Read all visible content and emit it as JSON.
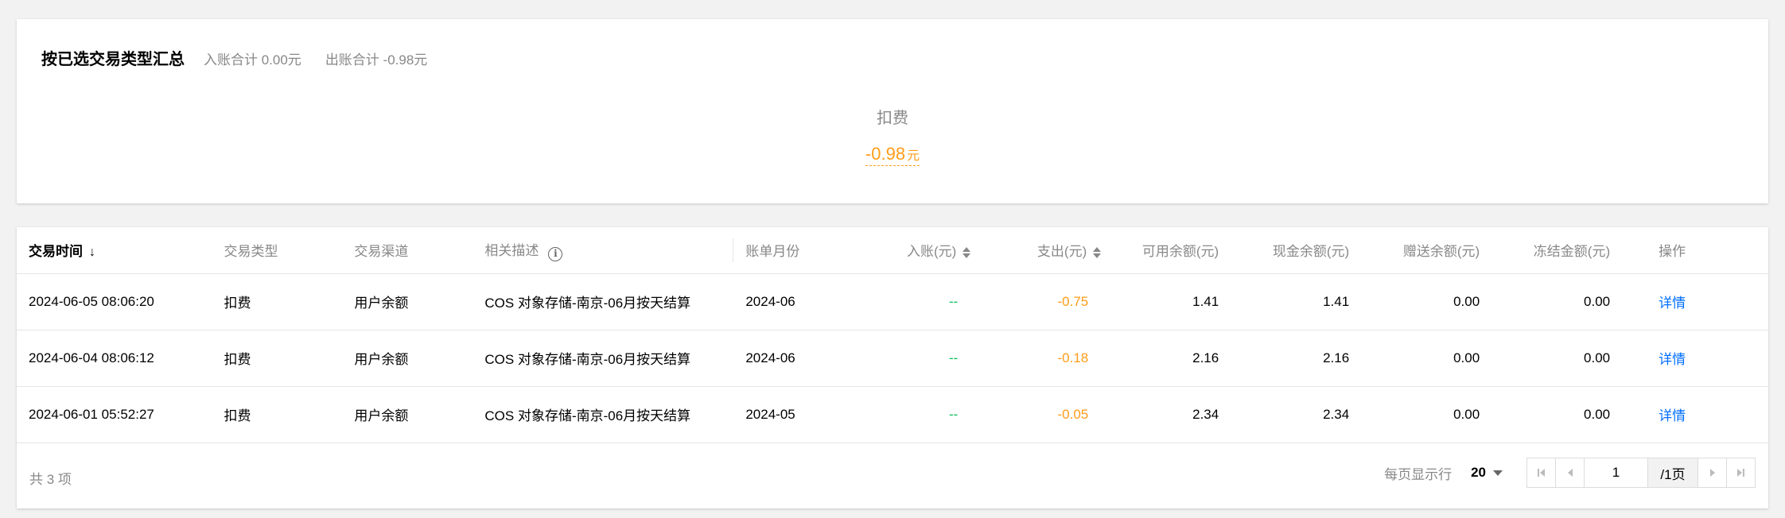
{
  "summary": {
    "title": "按已选交易类型汇总",
    "income_total": "入账合计 0.00元",
    "expense_total": "出账合计 -0.98元",
    "type_label": "扣费",
    "amount": "-0.98",
    "unit": "元"
  },
  "table": {
    "headers": {
      "time": "交易时间",
      "type": "交易类型",
      "channel": "交易渠道",
      "desc": "相关描述",
      "month": "账单月份",
      "income": "入账(元)",
      "expense": "支出(元)",
      "available": "可用余额(元)",
      "cash": "现金余额(元)",
      "gift": "赠送余额(元)",
      "frozen": "冻结金额(元)",
      "action": "操作"
    },
    "rows": [
      {
        "time": "2024-06-05 08:06:20",
        "type": "扣费",
        "channel": "用户余额",
        "desc": "COS 对象存储-南京-06月按天结算",
        "month": "2024-06",
        "income": "--",
        "expense": "-0.75",
        "available": "1.41",
        "cash": "1.41",
        "gift": "0.00",
        "frozen": "0.00",
        "action": "详情"
      },
      {
        "time": "2024-06-04 08:06:12",
        "type": "扣费",
        "channel": "用户余额",
        "desc": "COS 对象存储-南京-06月按天结算",
        "month": "2024-06",
        "income": "--",
        "expense": "-0.18",
        "available": "2.16",
        "cash": "2.16",
        "gift": "0.00",
        "frozen": "0.00",
        "action": "详情"
      },
      {
        "time": "2024-06-01 05:52:27",
        "type": "扣费",
        "channel": "用户余额",
        "desc": "COS 对象存储-南京-06月按天结算",
        "month": "2024-05",
        "income": "--",
        "expense": "-0.05",
        "available": "2.34",
        "cash": "2.34",
        "gift": "0.00",
        "frozen": "0.00",
        "action": "详情"
      }
    ]
  },
  "footer": {
    "total": "共 3 项",
    "rows_per_page_label": "每页显示行",
    "page_size": "20",
    "current_page": "1",
    "total_pages": "/1页"
  },
  "colors": {
    "negative": "#ff9c19",
    "empty": "#0abf5b",
    "link": "#006eff"
  }
}
